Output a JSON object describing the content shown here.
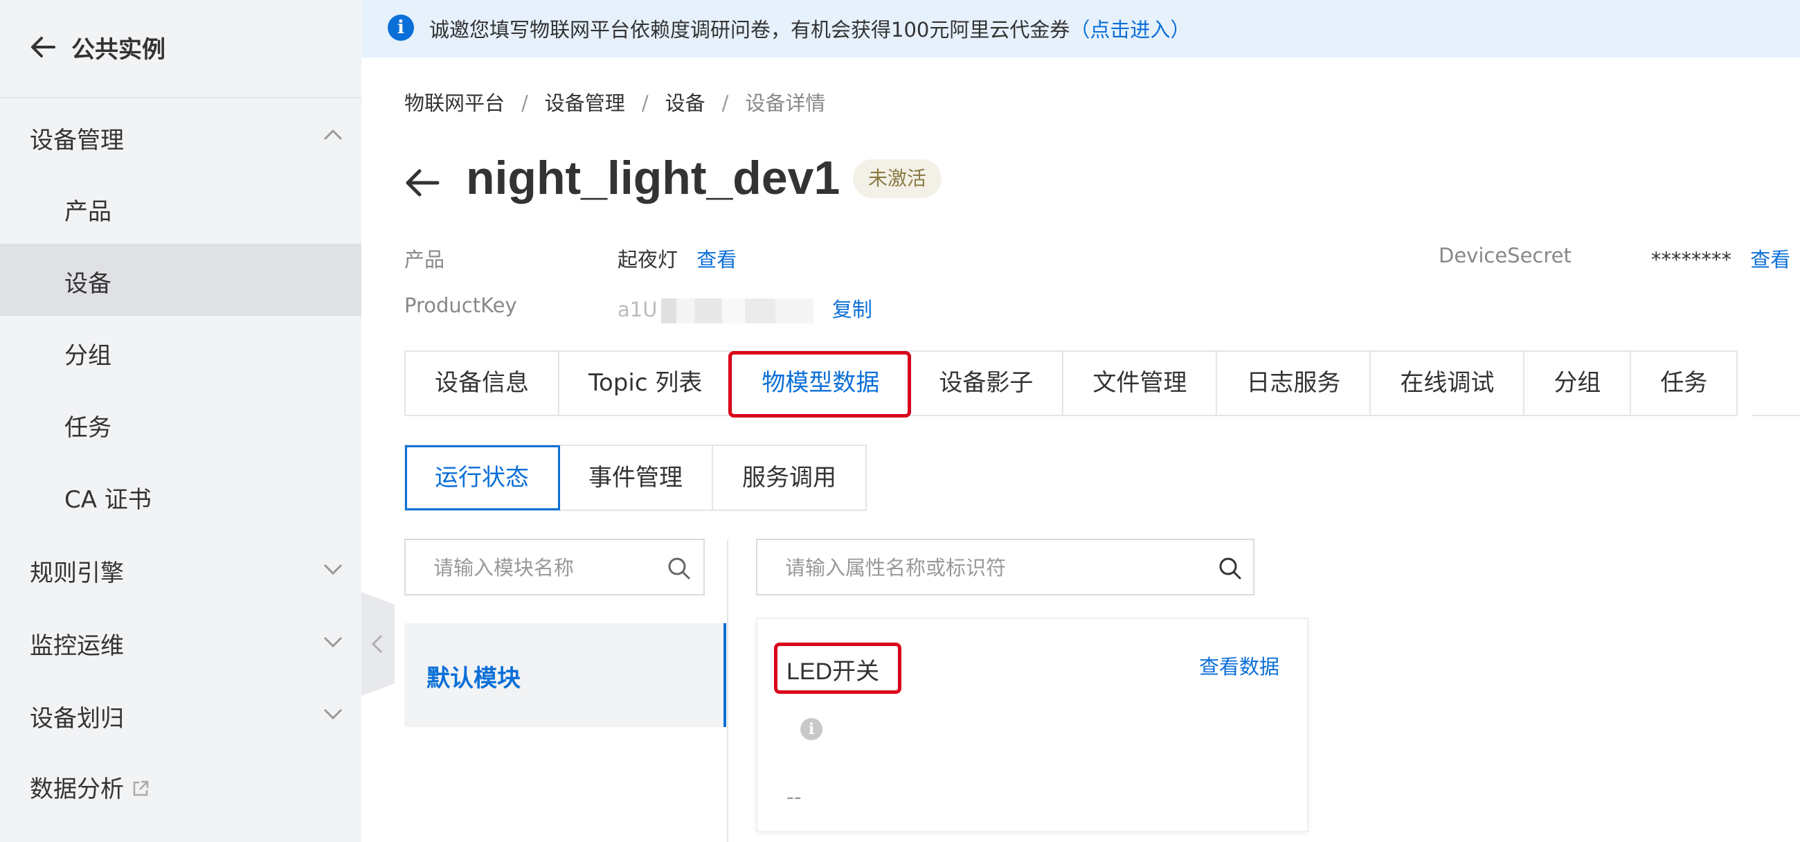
{
  "sidebar": {
    "header_title": "公共实例",
    "groups": [
      {
        "label": "设备管理",
        "expanded": true
      },
      {
        "label": "规则引擎",
        "expanded": false
      },
      {
        "label": "监控运维",
        "expanded": false
      },
      {
        "label": "设备划归",
        "expanded": false
      }
    ],
    "items": [
      {
        "label": "产品",
        "active": false
      },
      {
        "label": "设备",
        "active": true
      },
      {
        "label": "分组",
        "active": false
      },
      {
        "label": "任务",
        "active": false
      },
      {
        "label": "CA 证书",
        "active": false
      }
    ],
    "data_analysis_label": "数据分析"
  },
  "banner": {
    "text": "诚邀您填写物联网平台依赖度调研问卷，有机会获得100元阿里云代金券",
    "link": "（点击进入）"
  },
  "breadcrumb": [
    "物联网平台",
    "设备管理",
    "设备",
    "设备详情"
  ],
  "breadcrumb_sep": "/",
  "device": {
    "name": "night_light_dev1",
    "status": "未激活",
    "product_label": "产品",
    "product_value": "起夜灯",
    "product_link": "查看",
    "productkey_label": "ProductKey",
    "productkey_value": "a1U",
    "productkey_copy": "复制",
    "secret_label": "DeviceSecret",
    "secret_value": "********",
    "secret_link": "查看"
  },
  "tabs": [
    "设备信息",
    "Topic 列表",
    "物模型数据",
    "设备影子",
    "文件管理",
    "日志服务",
    "在线调试",
    "分组",
    "任务"
  ],
  "active_tab": "物模型数据",
  "subtabs": [
    "运行状态",
    "事件管理",
    "服务调用"
  ],
  "active_subtab": "运行状态",
  "module_search": {
    "placeholder": "请输入模块名称"
  },
  "property_search": {
    "placeholder": "请输入属性名称或标识符"
  },
  "modules": [
    {
      "label": "默认模块",
      "active": true
    }
  ],
  "property_card": {
    "name": "LED开关",
    "view_link": "查看数据",
    "value": "--"
  },
  "colors": {
    "accent": "#0b6fd8",
    "highlight_box": "#d9001b",
    "sidebar_bg": "#f2f3f5",
    "banner_bg": "#e6f1fc"
  }
}
